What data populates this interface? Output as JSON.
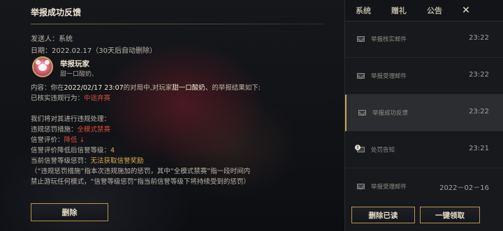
{
  "detail": {
    "title": "举报成功反馈",
    "sender": "发送人：系统",
    "date": "日期：2022.02.17（30天后自动删除）",
    "sender_card": {
      "name": "举报玩家",
      "sub": "甜一口酸奶、"
    },
    "body": [
      [
        {
          "t": "内容：你在"
        },
        {
          "t": "2022/02/17 23:07",
          "c": "white"
        },
        {
          "t": "的对局中,对玩家"
        },
        {
          "t": "甜一口酸奶、",
          "c": "white"
        },
        {
          "t": "的举报结果如下:"
        }
      ],
      [
        {
          "t": "已核实违规行为："
        },
        {
          "t": "中途弃赛",
          "c": "red"
        }
      ],
      [
        {
          "t": "我们将对其进行违规处理："
        }
      ],
      [
        {
          "t": "违规惩罚措施："
        },
        {
          "t": "全模式禁赛",
          "c": "red"
        }
      ],
      [
        {
          "t": "信誉评价："
        },
        {
          "t": "降低 ↓",
          "c": "red"
        }
      ],
      [
        {
          "t": "信誉评价降低后信誉等级："
        },
        {
          "t": "4",
          "c": "gold"
        }
      ],
      [
        {
          "t": "当前信誉等级惩罚："
        },
        {
          "t": "无法获取信誉奖励",
          "c": "gold"
        }
      ],
      [
        {
          "t": "（“违规惩罚措施”指本次违规施加的惩罚，其中“全模式禁赛”指一段时间内"
        }
      ],
      [
        {
          "t": "禁止游玩任何模式，“信誉等级惩罚”指当前信誉等级下将持续受到的惩罚）"
        }
      ]
    ],
    "delete_label": "删除"
  },
  "panel": {
    "tabs": [
      {
        "label": "系统",
        "active": true
      },
      {
        "label": "赠礼",
        "active": false
      },
      {
        "label": "公告",
        "active": false
      }
    ],
    "close_icon": "close-icon",
    "mails": [
      {
        "title": "举报核实邮件",
        "time": "23:22",
        "icon": "mail-icon",
        "selected": false
      },
      {
        "title": "举报受理邮件",
        "time": "23:22",
        "icon": "mail-icon",
        "selected": false
      },
      {
        "title": "举报成功反馈",
        "time": "23:22",
        "icon": "mail-icon",
        "selected": true
      },
      {
        "title": "处罚告知",
        "time": "23:21",
        "icon": "warning-mail-icon",
        "selected": false
      },
      {
        "title": "举报受理邮件",
        "time": "2022－02－16",
        "icon": "mail-icon",
        "selected": false
      }
    ],
    "delete_read_label": "删除已读",
    "claim_all_label": "一键领取"
  },
  "colors": {
    "accent_gold": "#c9a55c",
    "highlight_red": "#d9493a",
    "highlight_gold": "#d8b04a"
  }
}
